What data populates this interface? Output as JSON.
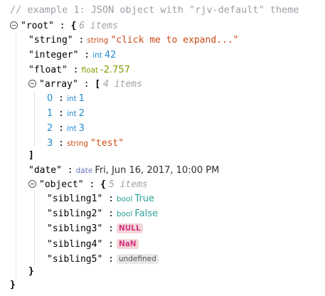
{
  "comment": "// example 1: JSON object with \"rjv-default\" theme",
  "root": {
    "key": "\"root\"",
    "colon": ":",
    "open": "{",
    "close": "}",
    "count": "6 items"
  },
  "string_row": {
    "key": "\"string\"",
    "colon": ":",
    "type": "string",
    "value": "\"click me to expand...\""
  },
  "integer_row": {
    "key": "\"integer\"",
    "colon": ":",
    "type": "int",
    "value": "42"
  },
  "float_row": {
    "key": "\"float\"",
    "colon": ":",
    "type": "float",
    "value": "-2.757"
  },
  "array": {
    "key": "\"array\"",
    "colon": ":",
    "open": "[",
    "close": "]",
    "count": "4 items",
    "items": [
      {
        "index": "0",
        "colon": ":",
        "type": "int",
        "value": "1"
      },
      {
        "index": "1",
        "colon": ":",
        "type": "int",
        "value": "2"
      },
      {
        "index": "2",
        "colon": ":",
        "type": "int",
        "value": "3"
      },
      {
        "index": "3",
        "colon": ":",
        "type": "string",
        "value": "\"test\""
      }
    ]
  },
  "date_row": {
    "key": "\"date\"",
    "colon": ":",
    "type": "date",
    "value": "Fri, Jun 16, 2017, 10:00 PM"
  },
  "object": {
    "key": "\"object\"",
    "colon": ":",
    "open": "{",
    "close": "}",
    "count": "5 items",
    "items": [
      {
        "key": "\"sibling1\"",
        "colon": ":",
        "type": "bool",
        "value": "True"
      },
      {
        "key": "\"sibling2\"",
        "colon": ":",
        "type": "bool",
        "value": "False"
      },
      {
        "key": "\"sibling3\"",
        "colon": ":",
        "badge": "NULL"
      },
      {
        "key": "\"sibling4\"",
        "colon": ":",
        "badge": "NaN"
      },
      {
        "key": "\"sibling5\"",
        "colon": ":",
        "badge": "undefined"
      }
    ]
  }
}
